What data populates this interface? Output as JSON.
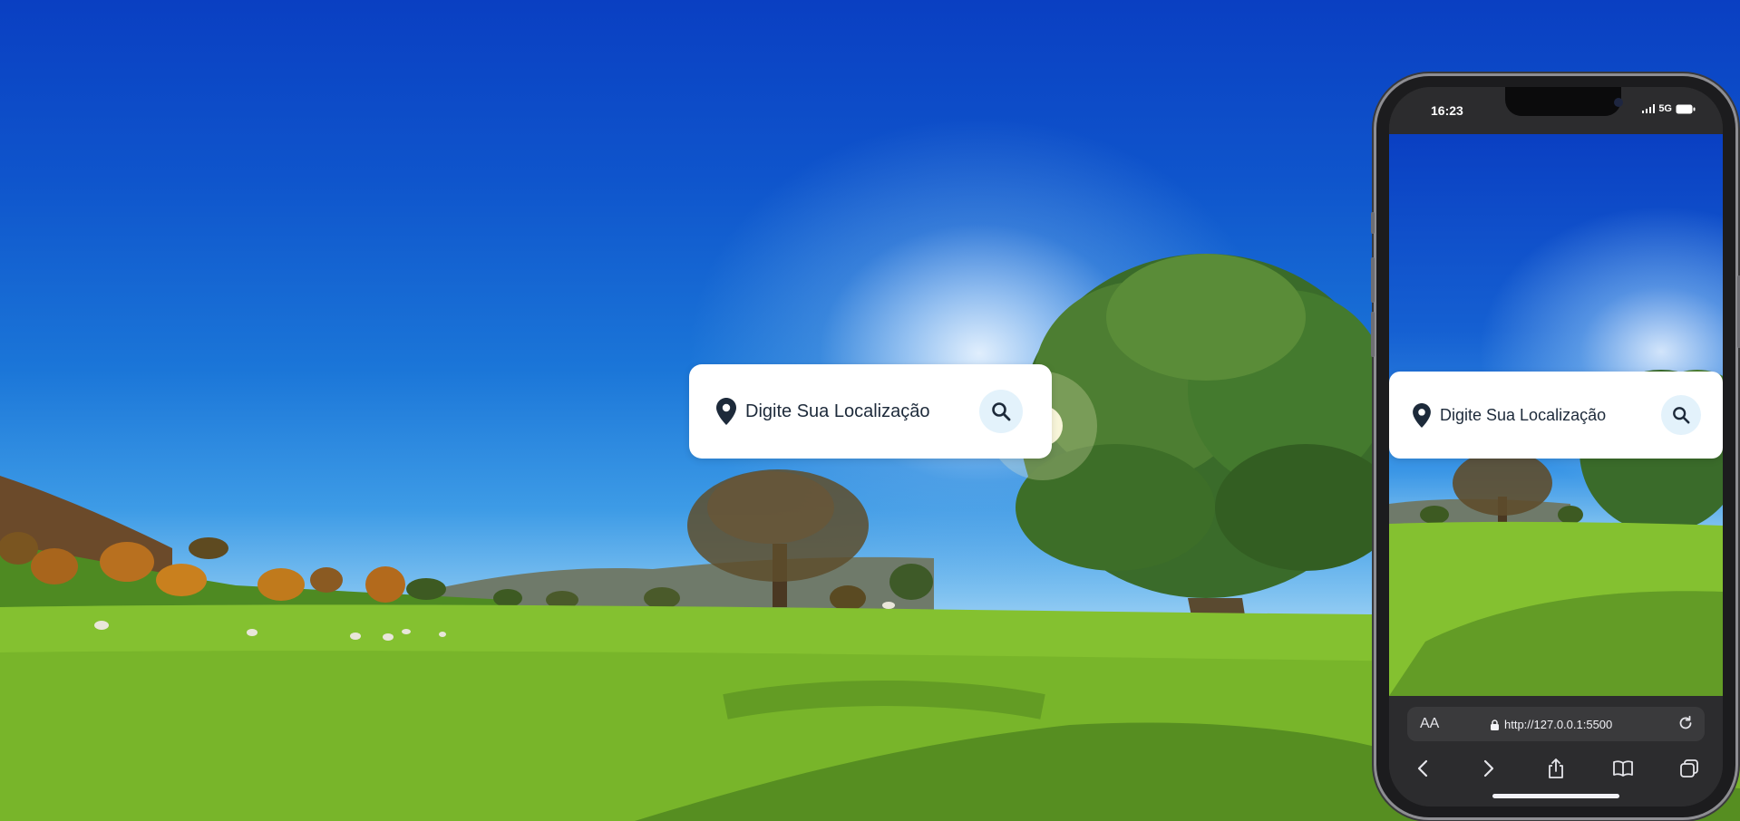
{
  "search": {
    "placeholder": "Digite Sua Localização",
    "pin_icon": "map-pin-icon",
    "search_icon": "search-icon"
  },
  "phone": {
    "time": "16:23",
    "network": "5G",
    "browser": {
      "aa_label": "AA",
      "url": "http://127.0.0.1:5500"
    }
  },
  "colors": {
    "search_bg": "#ffffff",
    "search_button_bg": "#e3f2fb",
    "icon_color": "#1d2a3a",
    "sky_top": "#0a3fc2",
    "grass": "#7dbb2d"
  }
}
